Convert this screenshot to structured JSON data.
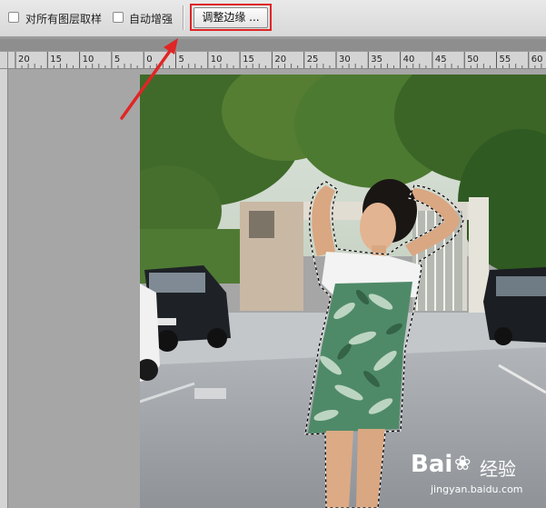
{
  "options_bar": {
    "checkbox_sample_all_layers": {
      "label": "对所有图层取样",
      "checked": false
    },
    "checkbox_auto_enhance": {
      "label": "自动增强",
      "checked": false
    },
    "refine_edge_button": "调整边缘 ..."
  },
  "ruler": {
    "tick_labels": [
      "20",
      "15",
      "10",
      "5",
      "0",
      "5",
      "10",
      "15",
      "20",
      "25",
      "30",
      "35",
      "40",
      "45",
      "50",
      "55",
      "60"
    ]
  },
  "watermark": {
    "brand": "Bai",
    "brand_suffix": "经验",
    "url": "jingyan.baidu.com"
  },
  "colors": {
    "annotation_red": "#e02525",
    "selection_marquee": "#ffffff"
  }
}
